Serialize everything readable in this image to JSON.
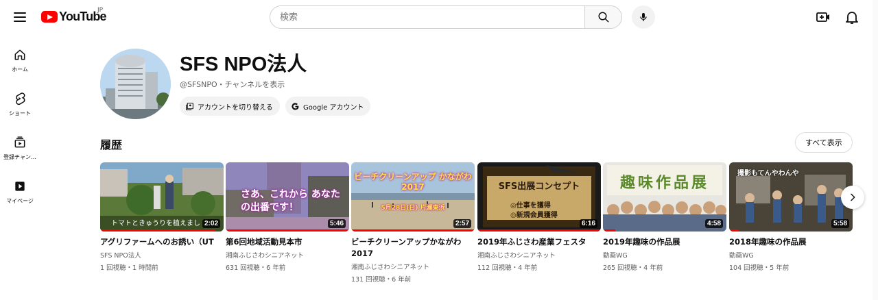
{
  "header": {
    "logo_text": "YouTube",
    "logo_region": "JP",
    "search_placeholder": "検索",
    "icons": [
      "menu-icon",
      "search-icon",
      "mic-icon",
      "create-icon",
      "bell-icon"
    ]
  },
  "sidebar": {
    "items": [
      {
        "label": "ホーム",
        "icon": "home-icon"
      },
      {
        "label": "ショート",
        "icon": "shorts-icon"
      },
      {
        "label": "登録チャン…",
        "icon": "subscriptions-icon"
      },
      {
        "label": "マイページ",
        "icon": "you-icon"
      }
    ]
  },
  "channel": {
    "name": "SFS NPO法人",
    "handle_line": "@SFSNPO・チャンネルを表示",
    "switch_account": "アカウントを切り替える",
    "google_account": "Google アカウント"
  },
  "history": {
    "title": "履歴",
    "see_all": "すべて表示",
    "videos": [
      {
        "title": "アグリファームへのお誘い（UT",
        "channel": "SFS NPO法人",
        "meta": "1 回視聴・1 時間前",
        "duration": "2:02",
        "thumb_caption": "トマトときゅうりを植えまし",
        "watched": 0.93
      },
      {
        "title": "第6回地域活動見本市",
        "channel": "湘南ふじさわシニアネット",
        "meta": "631 回視聴・6 年前",
        "duration": "5:46",
        "thumb_caption": "さあ、これから あなたの出番です！",
        "watched": 1.0
      },
      {
        "title": "ビーチクリーンアップかながわ2017",
        "channel": "湘南ふじさわシニアネット",
        "meta": "131 回視聴・6 年前",
        "duration": "2:57",
        "thumb_caption": "ビーチクリーンアップ かながわ2017",
        "thumb_date": "5月28日(日) 片瀬東浜",
        "watched": 1.0
      },
      {
        "title": "2019年ふじさわ産業フェスタ",
        "channel": "湘南ふじさわシニアネット",
        "meta": "112 回視聴・4 年前",
        "duration": "6:16",
        "thumb_caption": "SFS出展コンセプト",
        "thumb_points": [
          "◎仕事を獲得",
          "◎新規会員獲得"
        ],
        "watched": 1.0
      },
      {
        "title": "2019年趣味の作品展",
        "channel": "動画WG",
        "meta": "265 回視聴・4 年前",
        "duration": "4:58",
        "thumb_caption": "趣味作品展",
        "watched": 0.1
      },
      {
        "title": "2018年趣味の作品展",
        "channel": "動画WG",
        "meta": "104 回視聴・5 年前",
        "duration": "5:58",
        "thumb_caption": "撮影もてんやわんや",
        "watched": 0.08
      }
    ]
  }
}
